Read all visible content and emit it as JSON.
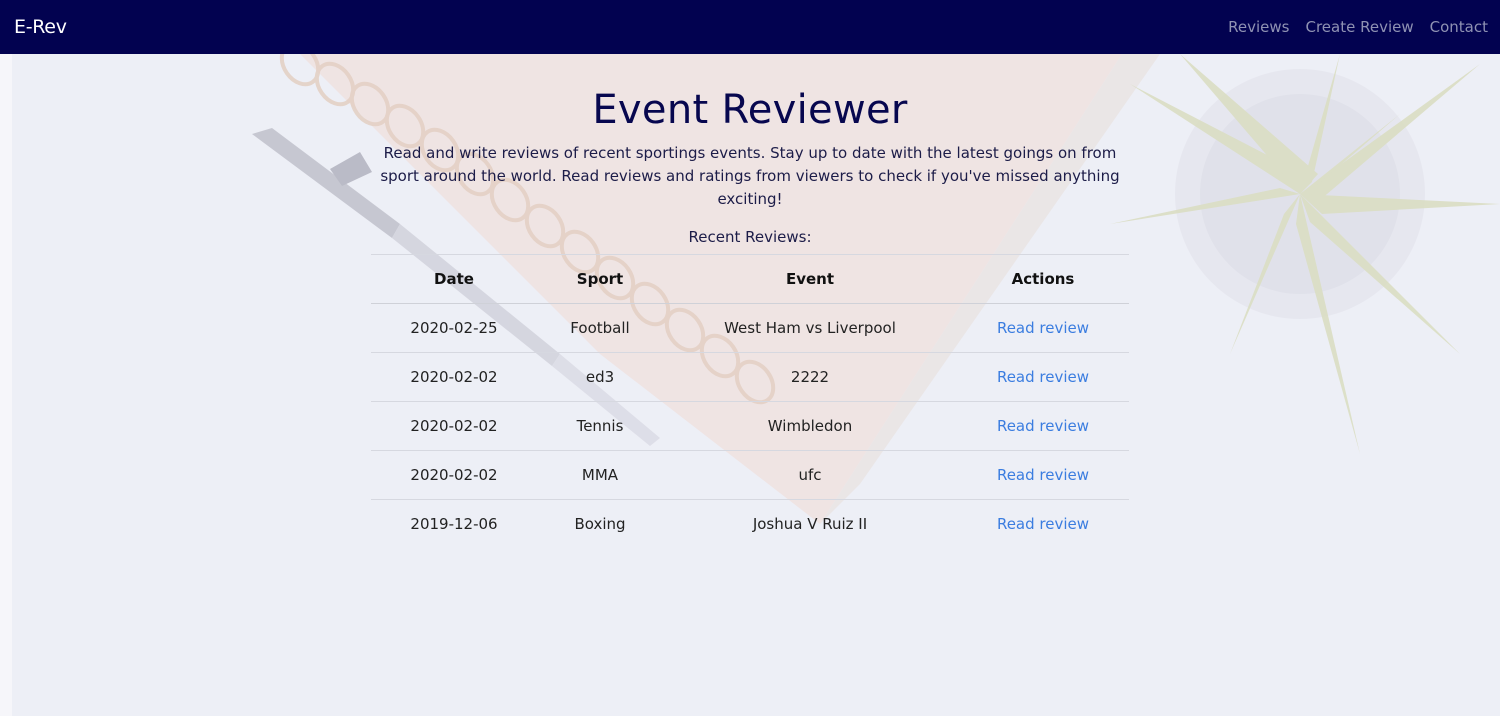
{
  "navbar": {
    "brand": "E-Rev",
    "links": [
      "Reviews",
      "Create Review",
      "Contact"
    ]
  },
  "hero": {
    "title": "Event Reviewer",
    "description": "Read and write reviews of recent sportings events. Stay up to date with the latest goings on from sport around the world. Read reviews and ratings from viewers to check if you've missed anything exciting!",
    "recent_label": "Recent Reviews:"
  },
  "table": {
    "headers": [
      "Date",
      "Sport",
      "Event",
      "Actions"
    ],
    "rows": [
      {
        "date": "2020-02-25",
        "sport": "Football",
        "event": "West Ham vs Liverpool",
        "action": "Read review"
      },
      {
        "date": "2020-02-02",
        "sport": "ed3",
        "event": "2222",
        "action": "Read review"
      },
      {
        "date": "2020-02-02",
        "sport": "Tennis",
        "event": "Wimbledon",
        "action": "Read review"
      },
      {
        "date": "2020-02-02",
        "sport": "MMA",
        "event": "ufc",
        "action": "Read review"
      },
      {
        "date": "2019-12-06",
        "sport": "Boxing",
        "event": "Joshua V Ruiz II",
        "action": "Read review"
      }
    ]
  },
  "colors": {
    "navbar": "#020250",
    "title": "#07074f",
    "link": "#3b7de0",
    "page_background": "#eceef6"
  },
  "icons": {
    "background": "desk-notebook-pen-plant-background-image"
  }
}
